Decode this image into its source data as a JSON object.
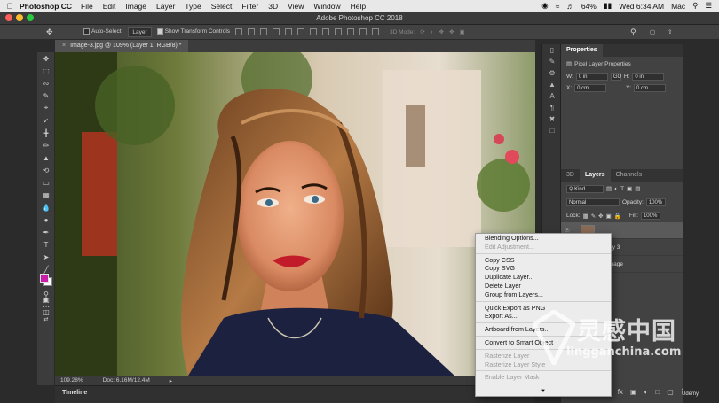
{
  "menubar": {
    "app_name": "Photoshop CC",
    "menus": [
      "File",
      "Edit",
      "Image",
      "Layer",
      "Type",
      "Select",
      "Filter",
      "3D",
      "View",
      "Window",
      "Help"
    ],
    "battery": "64%",
    "clock": "Wed 6:34 AM",
    "user": "Mac"
  },
  "window": {
    "title": "Adobe Photoshop CC 2018"
  },
  "options_bar": {
    "auto_select_label": "Auto-Select:",
    "auto_select_value": "Layer",
    "show_transform_label": "Show Transform Controls",
    "mode_3d_label": "3D Mode:"
  },
  "document": {
    "tab_title": "Image-3.jpg @ 109% (Layer 1, RGB/8) *",
    "zoom": "109.28%",
    "doc_size": "Doc: 6.16M/12.4M"
  },
  "timeline": {
    "label": "Timeline"
  },
  "properties": {
    "tab_label": "Properties",
    "subtitle": "Pixel Layer Properties",
    "w_label": "W:",
    "w_value": "0 in",
    "link_label": "GO",
    "h_label": "H:",
    "h_value": "0 in",
    "x_label": "X:",
    "x_value": "0 cm",
    "y_label": "Y:",
    "y_value": "0 cm"
  },
  "layers_panel": {
    "tabs": [
      "3D",
      "Layers",
      "Channels"
    ],
    "filter_kind": "Kind",
    "blend_mode": "Normal",
    "opacity_label": "Opacity:",
    "opacity_value": "100%",
    "lock_label": "Lock:",
    "fill_label": "Fill:",
    "fill_value": "100%",
    "rows": [
      {
        "name": "Layer 1"
      },
      {
        "name": "Layer 0 copy 3"
      },
      {
        "name": "Original image"
      }
    ],
    "row_name_fragments": [
      "",
      "0 copy 3",
      "nal image"
    ]
  },
  "context_menu": {
    "items": [
      {
        "label": "Blending Options...",
        "disabled": false
      },
      {
        "label": "Edit Adjustment...",
        "disabled": true
      },
      {
        "sep": true
      },
      {
        "label": "Copy CSS",
        "disabled": false
      },
      {
        "label": "Copy SVG",
        "disabled": false
      },
      {
        "label": "Duplicate Layer...",
        "disabled": false
      },
      {
        "label": "Delete Layer",
        "disabled": false
      },
      {
        "label": "Group from Layers...",
        "disabled": false
      },
      {
        "sep": true
      },
      {
        "label": "Quick Export as PNG",
        "disabled": false
      },
      {
        "label": "Export As...",
        "disabled": false
      },
      {
        "sep": true
      },
      {
        "label": "Artboard from Layers...",
        "disabled": false
      },
      {
        "sep": true
      },
      {
        "label": "Convert to Smart Object",
        "disabled": false
      },
      {
        "sep": true
      },
      {
        "label": "Rasterize Layer",
        "disabled": true
      },
      {
        "label": "Rasterize Layer Style",
        "disabled": true
      },
      {
        "sep": true
      },
      {
        "label": "Enable Layer Mask",
        "disabled": true
      }
    ]
  },
  "colors": {
    "foreground": "#c81ea8",
    "background": "#ffffff"
  },
  "watermark": {
    "chinese": "灵感中国",
    "url": "lingganchina.com"
  },
  "badge": {
    "udemy": "Udemy"
  }
}
